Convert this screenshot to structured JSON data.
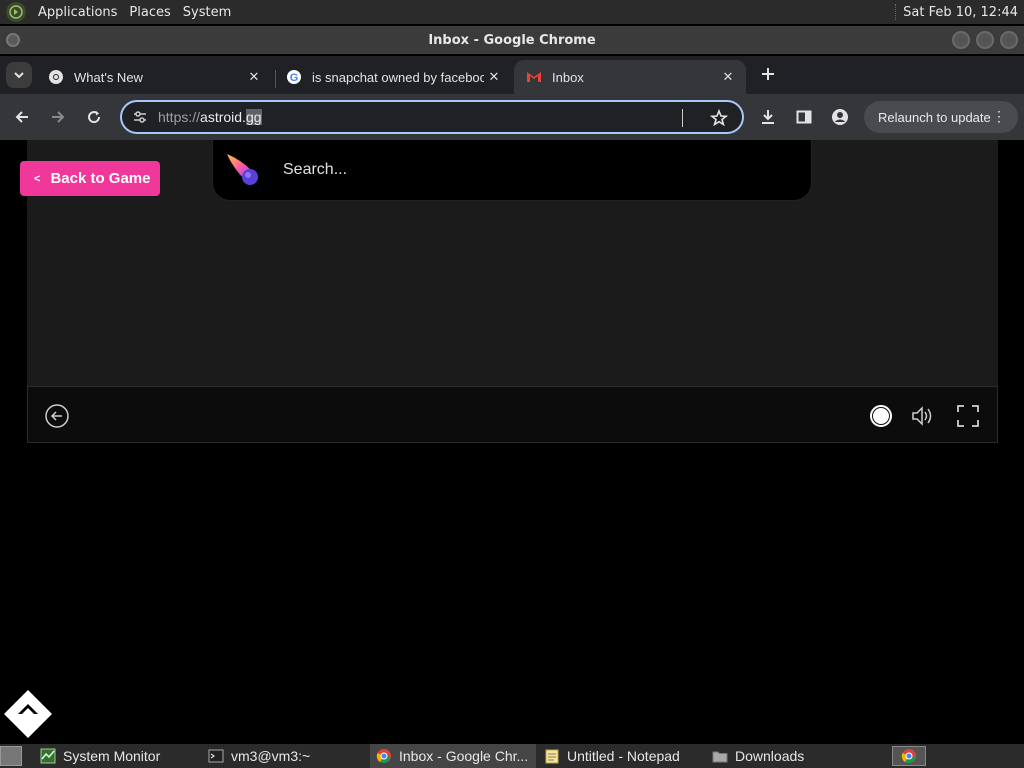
{
  "top_panel": {
    "menus": [
      "Applications",
      "Places",
      "System"
    ],
    "clock": "Sat Feb 10, 12:44"
  },
  "window": {
    "title": "Inbox - Google Chrome"
  },
  "tabs": [
    {
      "label": "What's New",
      "icon": "chrome-icon",
      "active": false
    },
    {
      "label": "is snapchat owned by facebook",
      "icon": "google-icon",
      "active": false
    },
    {
      "label": "Inbox",
      "icon": "gmail-icon",
      "active": true
    }
  ],
  "toolbar": {
    "url_scheme": "https://",
    "url_host": "astroid.",
    "url_selected": "gg",
    "relaunch_label": "Relaunch to update"
  },
  "page": {
    "back_button_label": "Back to Game",
    "search_placeholder": "Search..."
  },
  "taskbar": [
    {
      "label": "System Monitor",
      "icon": "system-monitor-icon",
      "active": false
    },
    {
      "label": "vm3@vm3:~",
      "icon": "terminal-icon",
      "active": false
    },
    {
      "label": "Inbox - Google Chr...",
      "icon": "chrome-icon",
      "active": true
    },
    {
      "label": "Untitled - Notepad",
      "icon": "notepad-icon",
      "active": false
    },
    {
      "label": "Downloads",
      "icon": "folder-icon",
      "active": false
    }
  ],
  "colors": {
    "accent_pink": "#f0389a",
    "omnibox_focus": "#a8c7fa",
    "chrome_toolbar": "#35363a"
  }
}
